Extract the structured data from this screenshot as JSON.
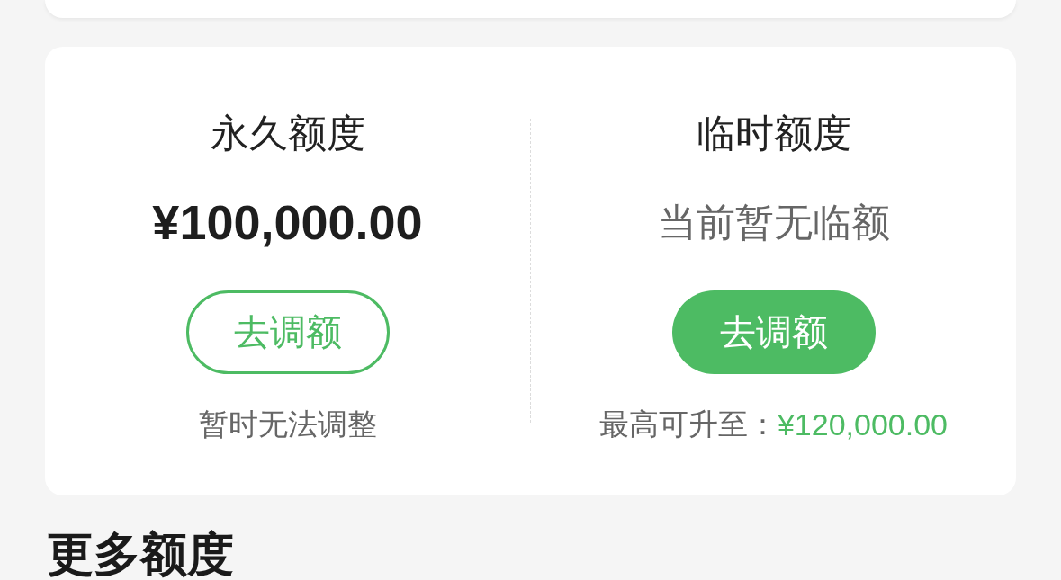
{
  "quota_card": {
    "columns": [
      {
        "title": "永久额度",
        "value": {
          "kind": "amount",
          "text": "¥100,000.00"
        },
        "button": {
          "kind": "outline",
          "label": "去调额"
        },
        "note": {
          "text": "暂时无法调整"
        }
      },
      {
        "title": "临时额度",
        "value": {
          "kind": "empty",
          "text": "当前暂无临额"
        },
        "button": {
          "kind": "filled",
          "label": "去调额"
        },
        "note": {
          "text": "最高可升至：",
          "amount": "¥120,000.00"
        }
      }
    ]
  },
  "section_heading": {
    "title": "更多额度"
  }
}
